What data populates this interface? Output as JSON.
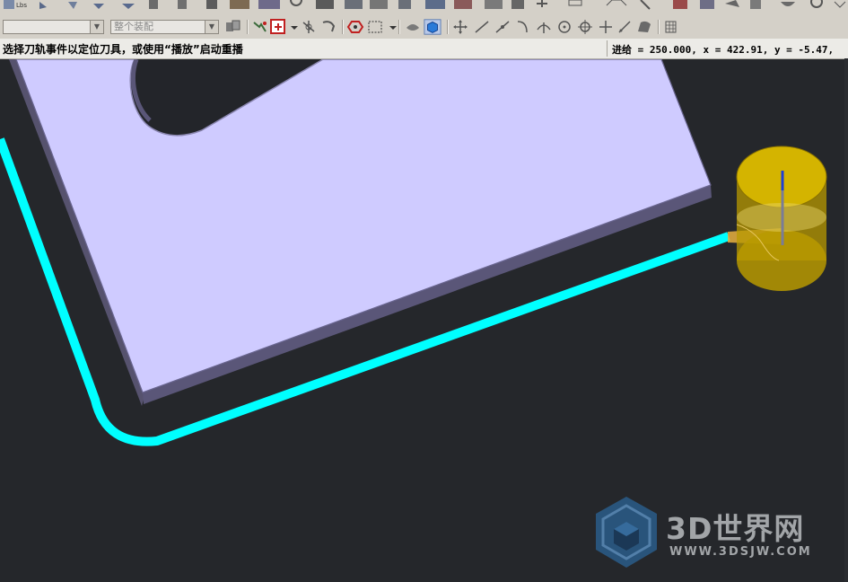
{
  "toolbar": {
    "filter_combo_value": "",
    "assembly_combo_value": "整个装配"
  },
  "status": {
    "message": "选择刀轨事件以定位刀具，或使用“播放”启动重播",
    "coordinates": "进给 = 250.000, x = 422.91, y = -5.47,"
  },
  "viewport": {
    "background_color": "#25272b",
    "part_top_color": "#cfcbff",
    "part_side_color": "#585474",
    "toolpath_color": "#00ffff",
    "tool_color": "#e8c400"
  },
  "watermark": {
    "name": "3D世界网",
    "url": "WWW.3DSJW.COM"
  }
}
